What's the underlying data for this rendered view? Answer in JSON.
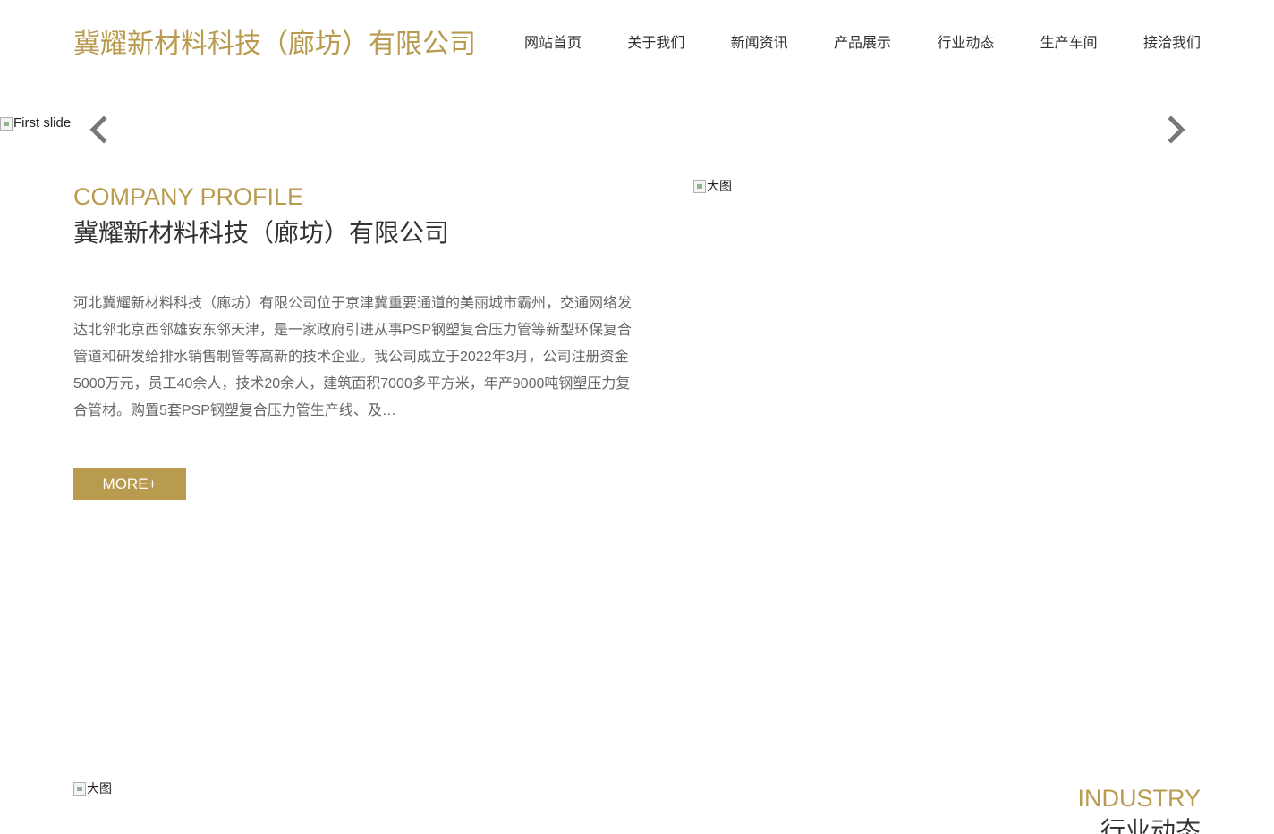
{
  "header": {
    "brand": "冀耀新材料科技（廊坊）有限公司",
    "nav": [
      {
        "label": "网站首页"
      },
      {
        "label": "关于我们"
      },
      {
        "label": "新闻资讯"
      },
      {
        "label": "产品展示"
      },
      {
        "label": "行业动态"
      },
      {
        "label": "生产车间"
      },
      {
        "label": "接洽我们"
      }
    ]
  },
  "carousel": {
    "slide_alt": "First slide",
    "prev_icon": "chevron-left-icon",
    "next_icon": "chevron-right-icon"
  },
  "profile": {
    "title_en": "COMPANY PROFILE",
    "title_cn": "冀耀新材料科技（廊坊）有限公司",
    "description": "河北冀耀新材料科技（廊坊）有限公司位于京津冀重要通道的美丽城市霸州，交通网络发达北邻北京西邻雄安东邻天津，是一家政府引进从事PSP钢塑复合压力管等新型环保复合管道和研发给排水销售制管等高新的技术企业。我公司成立于2022年3月，公司注册资金5000万元，员工40余人，技术20余人，建筑面积7000多平方米，年产9000吨钢塑压力复合管材。购置5套PSP钢塑复合压力管生产线、及…",
    "more_label": "MORE+",
    "image_alt": "大图"
  },
  "industry": {
    "image_alt": "大图",
    "title_en": "INDUSTRY",
    "title_cn": "行业动态"
  },
  "colors": {
    "accent": "#b89b4f",
    "text_dark": "#333333",
    "text_body": "#666666"
  }
}
